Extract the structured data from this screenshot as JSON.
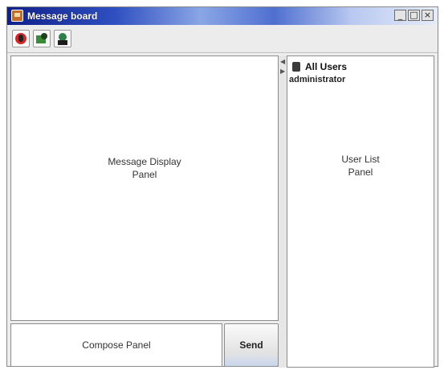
{
  "window": {
    "title": "Message board",
    "controls": {
      "minimize": "_",
      "maximize": "□",
      "close": "×"
    }
  },
  "toolbar": {
    "buttons": [
      {
        "icon": "user-status-icon"
      },
      {
        "icon": "add-user-icon"
      },
      {
        "icon": "user-profile-icon"
      }
    ]
  },
  "message_panel": {
    "label_line1": "Message Display",
    "label_line2": "Panel"
  },
  "compose_panel": {
    "label": "Compose Panel"
  },
  "send_button": {
    "label": "Send"
  },
  "user_list": {
    "header": "All Users",
    "items": [
      "administrator"
    ],
    "label_line1": "User List",
    "label_line2": "Panel"
  },
  "divider": {
    "left_arrow": "◀",
    "right_arrow": "▶"
  }
}
